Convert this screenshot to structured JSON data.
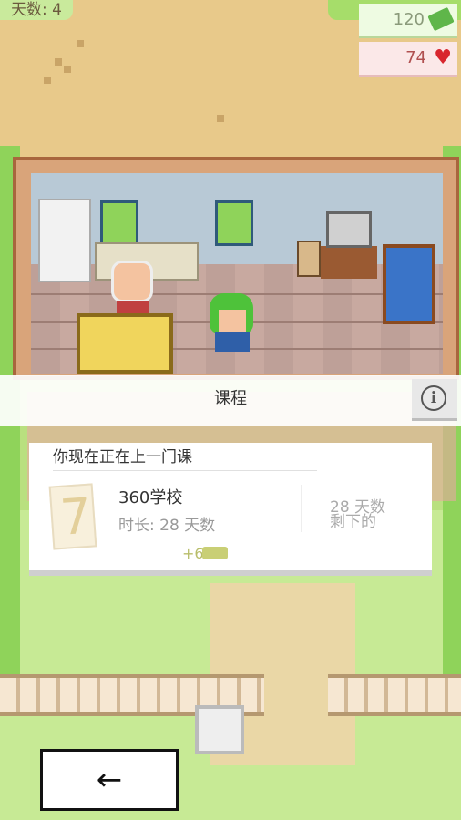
{
  "hud": {
    "day_label": "天数: 4",
    "money": "120",
    "health": "74"
  },
  "course_panel": {
    "title": "课程",
    "info_glyph": "i",
    "heading": "你现在正在上一门课",
    "school_name": "360学校",
    "duration": "时长: 28 天数",
    "days_left": "28 天数",
    "remaining_label": "剩下的",
    "reward": "+6"
  },
  "navigation": {
    "back_glyph": "←"
  },
  "colors": {
    "money_icon": "#5fb64a",
    "heart": "#d8262e",
    "card_bg": "#ffffff"
  },
  "icons": [
    "money-icon",
    "heart-icon",
    "info-icon",
    "document-icon",
    "gamepad-icon",
    "back-arrow-icon"
  ]
}
